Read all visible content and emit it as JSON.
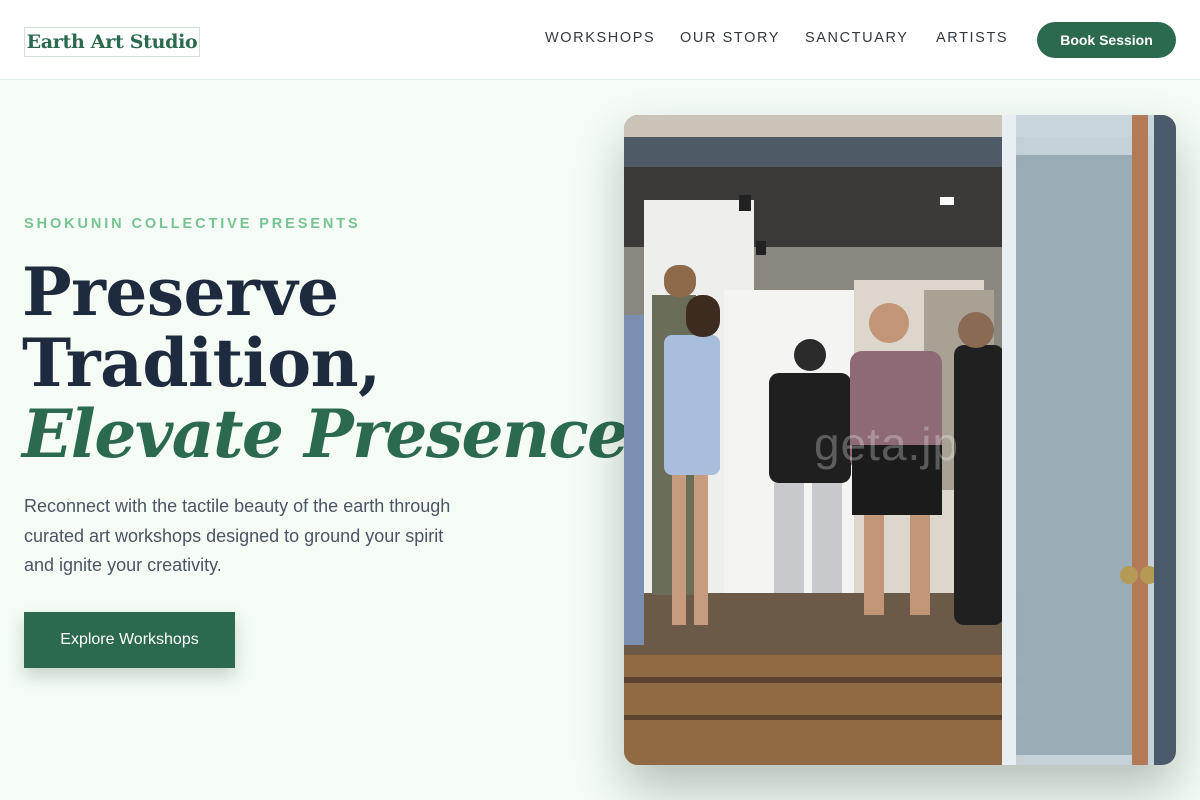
{
  "header": {
    "logo": "Earth Art Studio",
    "nav": [
      "WORKSHOPS",
      "OUR STORY",
      "SANCTUARY",
      "ARTISTS"
    ],
    "cta": "Book Session"
  },
  "hero": {
    "eyebrow": "SHOKUNIN COLLECTIVE PRESENTS",
    "headline_line1": "Preserve",
    "headline_line2": "Tradition,",
    "headline_accent": "Elevate Presence.",
    "description": "Reconnect with the tactile beauty of the earth through curated art workshops designed to ground your spirit and ignite your creativity.",
    "cta": "Explore Workshops"
  },
  "photo": {
    "watermark": "geta.jp"
  },
  "colors": {
    "brand": "#2c6a4f",
    "accent_light": "#78c394",
    "page_background": "#f4fcf5",
    "heading": "#1e2a3e"
  }
}
